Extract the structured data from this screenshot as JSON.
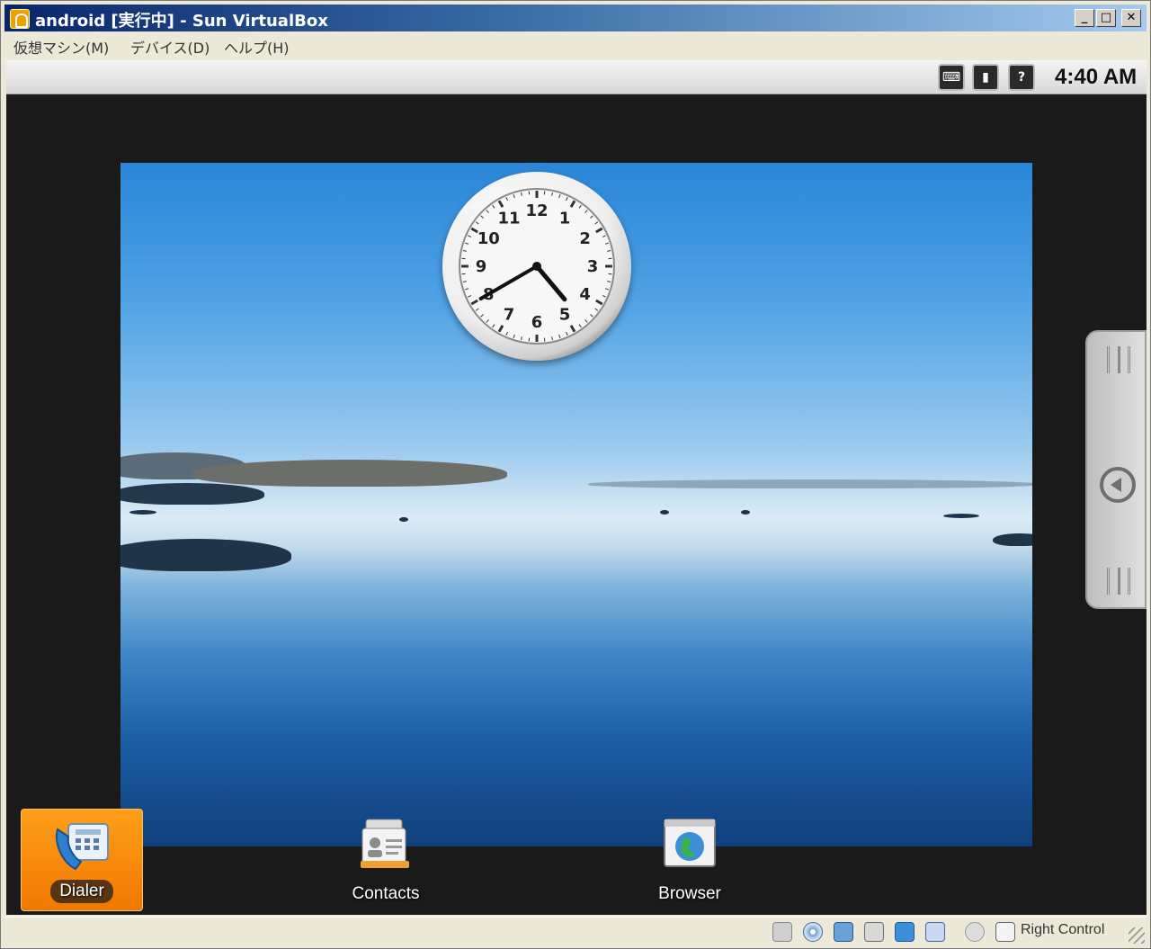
{
  "window": {
    "title": "android [実行中] - Sun VirtualBox",
    "buttons": {
      "minimize": "_",
      "maximize": "□",
      "close": "✕"
    }
  },
  "menubar": {
    "items": [
      {
        "label": "仮想マシン(M)"
      },
      {
        "label": "デバイス(D)"
      },
      {
        "label": "ヘルプ(H)"
      }
    ]
  },
  "android_status": {
    "icons": [
      "keyboard-icon",
      "signal-icon",
      "help-icon"
    ],
    "time": "4:40 AM"
  },
  "home": {
    "clock_numbers": [
      "12",
      "1",
      "2",
      "3",
      "4",
      "5",
      "6",
      "7",
      "8",
      "9",
      "10",
      "11"
    ],
    "clock_time": {
      "hour": 4,
      "minute": 40
    },
    "dock": [
      {
        "label": "Dialer",
        "selected": true
      },
      {
        "label": "Contacts",
        "selected": false
      },
      {
        "label": "Browser",
        "selected": false
      }
    ]
  },
  "vbox_status": {
    "host_key": "Right Control",
    "icons": [
      "hard-disk-icon",
      "cd-icon",
      "network-icon",
      "usb-icon",
      "shared-folder-icon",
      "display-icon",
      "mouse-integration-icon",
      "host-key-icon"
    ]
  },
  "colors": {
    "title_gradient_start": "#0a246a",
    "selected_app": "#f07800",
    "screen_bg": "#1a1a1a"
  }
}
